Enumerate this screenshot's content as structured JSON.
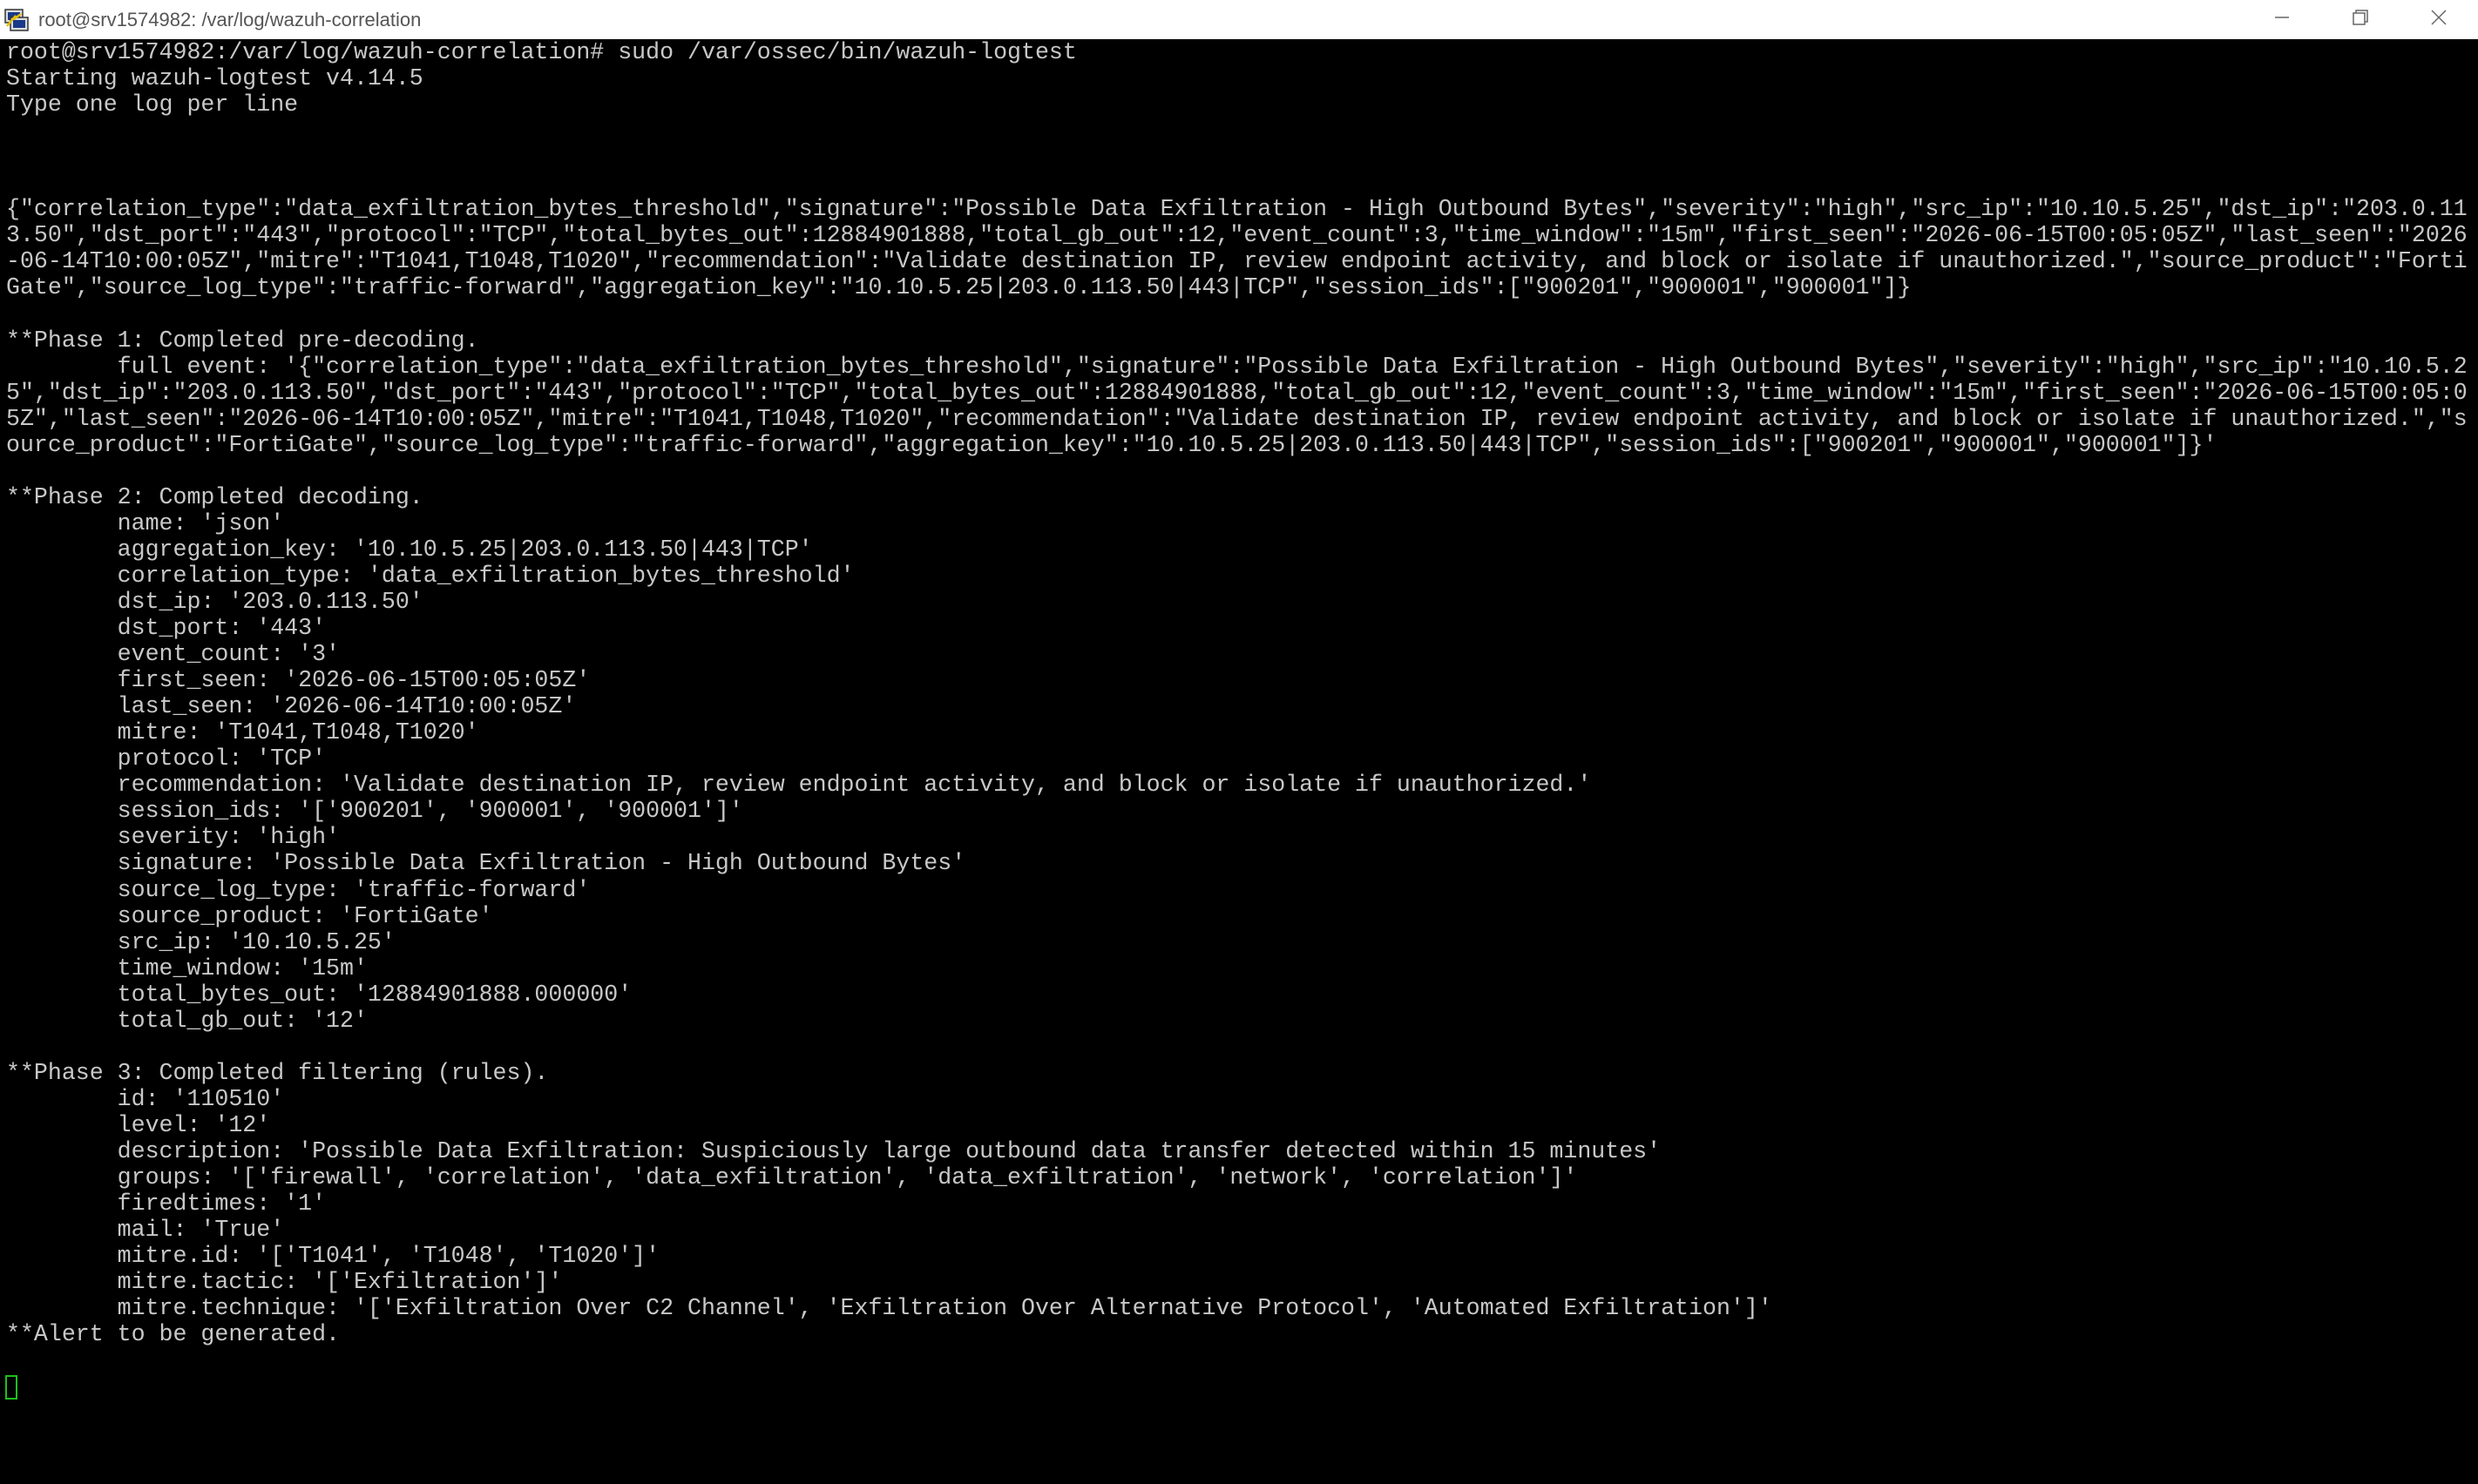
{
  "window": {
    "title": "root@srv1574982: /var/log/wazuh-correlation",
    "icons": [
      "putty-terminal-icon",
      "minimize-icon",
      "maximize-icon",
      "close-icon"
    ]
  },
  "colors": {
    "background": "#000000",
    "text": "#c8c8c8",
    "cursor": "#1ec01e",
    "titlebar": "#ffffff"
  },
  "terminal": {
    "lines": [
      "root@srv1574982:/var/log/wazuh-correlation# sudo /var/ossec/bin/wazuh-logtest",
      "Starting wazuh-logtest v4.14.5",
      "Type one log per line",
      "",
      "",
      "",
      "{\"correlation_type\":\"data_exfiltration_bytes_threshold\",\"signature\":\"Possible Data Exfiltration - High Outbound Bytes\",\"severity\":\"high\",\"src_ip\":\"10.10.5.25\",\"dst_ip\":\"203.0.11",
      "3.50\",\"dst_port\":\"443\",\"protocol\":\"TCP\",\"total_bytes_out\":12884901888,\"total_gb_out\":12,\"event_count\":3,\"time_window\":\"15m\",\"first_seen\":\"2026-06-15T00:05:05Z\",\"last_seen\":\"2026",
      "-06-14T10:00:05Z\",\"mitre\":\"T1041,T1048,T1020\",\"recommendation\":\"Validate destination IP, review endpoint activity, and block or isolate if unauthorized.\",\"source_product\":\"Forti",
      "Gate\",\"source_log_type\":\"traffic-forward\",\"aggregation_key\":\"10.10.5.25|203.0.113.50|443|TCP\",\"session_ids\":[\"900201\",\"900001\",\"900001\"]}",
      "",
      "**Phase 1: Completed pre-decoding.",
      "        full event: '{\"correlation_type\":\"data_exfiltration_bytes_threshold\",\"signature\":\"Possible Data Exfiltration - High Outbound Bytes\",\"severity\":\"high\",\"src_ip\":\"10.10.5.2",
      "5\",\"dst_ip\":\"203.0.113.50\",\"dst_port\":\"443\",\"protocol\":\"TCP\",\"total_bytes_out\":12884901888,\"total_gb_out\":12,\"event_count\":3,\"time_window\":\"15m\",\"first_seen\":\"2026-06-15T00:05:0",
      "5Z\",\"last_seen\":\"2026-06-14T10:00:05Z\",\"mitre\":\"T1041,T1048,T1020\",\"recommendation\":\"Validate destination IP, review endpoint activity, and block or isolate if unauthorized.\",\"s",
      "ource_product\":\"FortiGate\",\"source_log_type\":\"traffic-forward\",\"aggregation_key\":\"10.10.5.25|203.0.113.50|443|TCP\",\"session_ids\":[\"900201\",\"900001\",\"900001\"]}'",
      "",
      "**Phase 2: Completed decoding.",
      "        name: 'json'",
      "        aggregation_key: '10.10.5.25|203.0.113.50|443|TCP'",
      "        correlation_type: 'data_exfiltration_bytes_threshold'",
      "        dst_ip: '203.0.113.50'",
      "        dst_port: '443'",
      "        event_count: '3'",
      "        first_seen: '2026-06-15T00:05:05Z'",
      "        last_seen: '2026-06-14T10:00:05Z'",
      "        mitre: 'T1041,T1048,T1020'",
      "        protocol: 'TCP'",
      "        recommendation: 'Validate destination IP, review endpoint activity, and block or isolate if unauthorized.'",
      "        session_ids: '['900201', '900001', '900001']'",
      "        severity: 'high'",
      "        signature: 'Possible Data Exfiltration - High Outbound Bytes'",
      "        source_log_type: 'traffic-forward'",
      "        source_product: 'FortiGate'",
      "        src_ip: '10.10.5.25'",
      "        time_window: '15m'",
      "        total_bytes_out: '12884901888.000000'",
      "        total_gb_out: '12'",
      "",
      "**Phase 3: Completed filtering (rules).",
      "        id: '110510'",
      "        level: '12'",
      "        description: 'Possible Data Exfiltration: Suspiciously large outbound data transfer detected within 15 minutes'",
      "        groups: '['firewall', 'correlation', 'data_exfiltration', 'data_exfiltration', 'network', 'correlation']'",
      "        firedtimes: '1'",
      "        mail: 'True'",
      "        mitre.id: '['T1041', 'T1048', 'T1020']'",
      "        mitre.tactic: '['Exfiltration']'",
      "        mitre.technique: '['Exfiltration Over C2 Channel', 'Exfiltration Over Alternative Protocol', 'Automated Exfiltration']'",
      "**Alert to be generated."
    ]
  }
}
